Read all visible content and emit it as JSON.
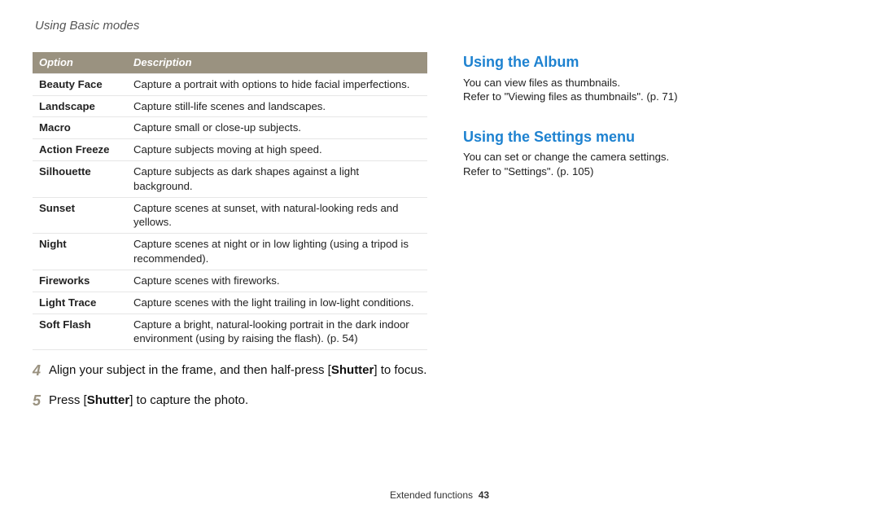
{
  "breadcrumb": "Using Basic modes",
  "table": {
    "head": {
      "opt": "Option",
      "desc": "Description"
    },
    "rows": [
      {
        "opt": "Beauty Face",
        "desc": "Capture a portrait with options to hide facial imperfections."
      },
      {
        "opt": "Landscape",
        "desc": "Capture still-life scenes and landscapes."
      },
      {
        "opt": "Macro",
        "desc": "Capture small or close-up subjects."
      },
      {
        "opt": "Action Freeze",
        "desc": "Capture subjects moving at high speed."
      },
      {
        "opt": "Silhouette",
        "desc": "Capture subjects as dark shapes against a light background."
      },
      {
        "opt": "Sunset",
        "desc": "Capture scenes at sunset, with natural-looking reds and yellows."
      },
      {
        "opt": "Night",
        "desc": "Capture scenes at night or in low lighting (using a tripod is recommended)."
      },
      {
        "opt": "Fireworks",
        "desc": "Capture scenes with fireworks."
      },
      {
        "opt": "Light Trace",
        "desc": "Capture scenes with the light trailing in low-light conditions."
      },
      {
        "opt": "Soft Flash",
        "desc": "Capture a bright, natural-looking portrait in the dark indoor environment (using by raising the flash). (p. 54)"
      }
    ]
  },
  "steps": {
    "s4": {
      "num": "4",
      "pre": "Align your subject in the frame, and then half-press [",
      "bold": "Shutter",
      "post": "] to focus."
    },
    "s5": {
      "num": "5",
      "pre": "Press [",
      "bold": "Shutter",
      "post": "] to capture the photo."
    }
  },
  "right": {
    "album": {
      "title": "Using the Album",
      "line1": "You can view files as thumbnails.",
      "line2": "Refer to \"Viewing files as thumbnails\". (p. 71)"
    },
    "settings": {
      "title": "Using the Settings menu",
      "line1": "You can set or change the camera settings.",
      "line2": "Refer to \"Settings\". (p. 105)"
    }
  },
  "footer": {
    "section": "Extended functions",
    "page": "43"
  }
}
